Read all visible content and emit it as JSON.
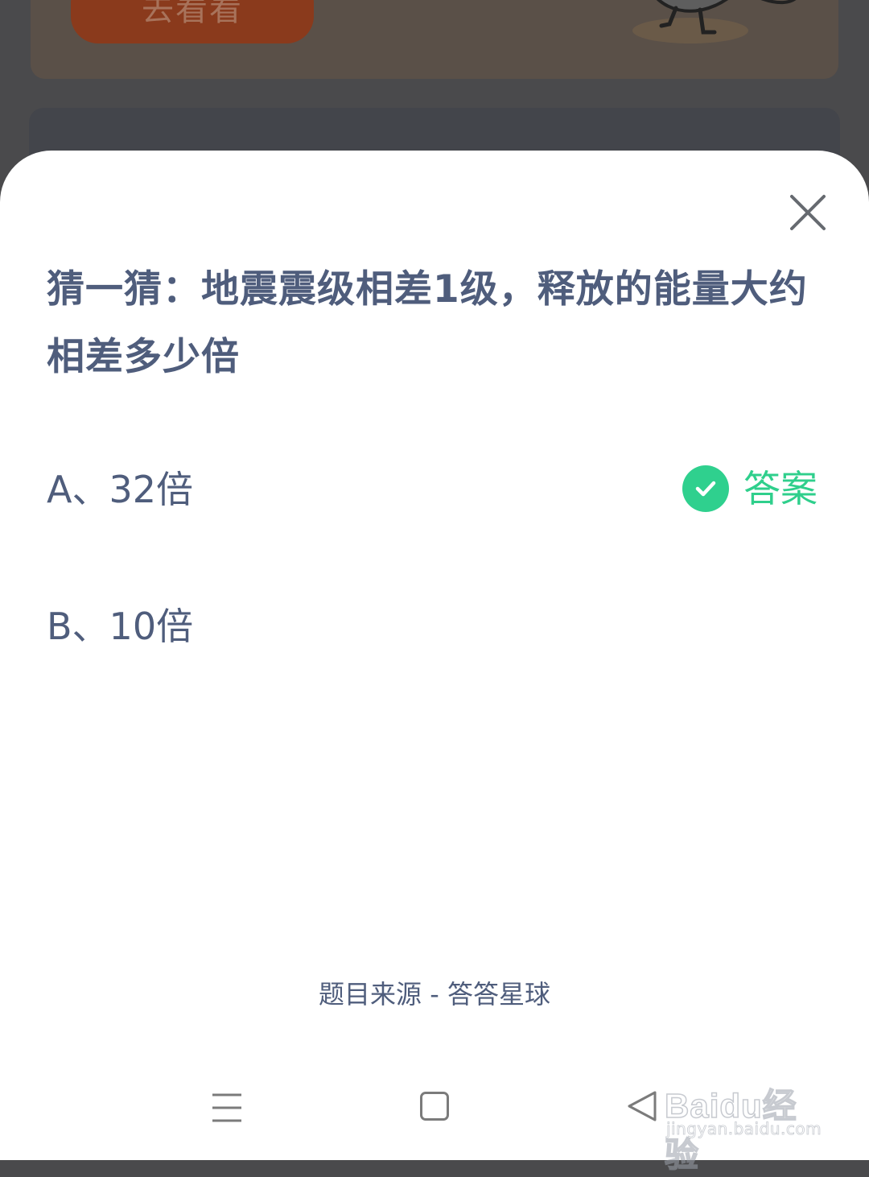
{
  "background": {
    "button_label": "去看看"
  },
  "sheet": {
    "question": "猜一猜：地震震级相差1级，释放的能量大约相差多少倍",
    "options": [
      {
        "label": "A、32倍"
      },
      {
        "label": "B、10倍"
      }
    ],
    "answer_label": "答案",
    "source": "题目来源 - 答答星球"
  },
  "watermark": {
    "logo": "Baidu经验",
    "url": "jingyan.baidu.com"
  },
  "colors": {
    "accent_green": "#2fcf8c",
    "text_primary": "#4f5d7c"
  }
}
